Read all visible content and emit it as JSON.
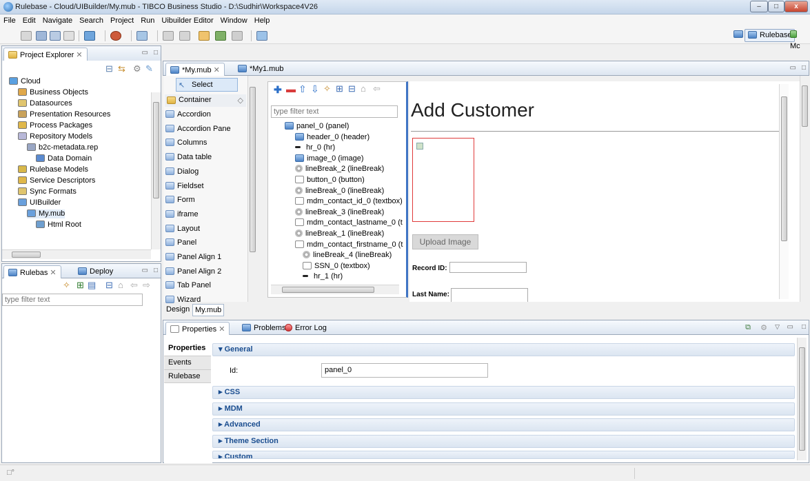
{
  "window": {
    "title": "Rulebase - Cloud/UIBuilder/My.mub - TIBCO Business Studio - D:\\Sudhir\\Workspace4V26",
    "minimize": "–",
    "maximize": "□",
    "close": "x"
  },
  "menu": [
    "File",
    "Edit",
    "Navigate",
    "Search",
    "Project",
    "Run",
    "Uibuilder Editor",
    "Window",
    "Help"
  ],
  "perspectives": {
    "rulebase": "Rulebase",
    "mc": "Mc"
  },
  "project_explorer": {
    "tab": "Project Explorer",
    "items": [
      {
        "label": "Cloud",
        "icon": "cloud-project-icon",
        "depth": 0
      },
      {
        "label": "Business Objects",
        "icon": "business-objects-icon",
        "depth": 1
      },
      {
        "label": "Datasources",
        "icon": "datasources-icon",
        "depth": 1
      },
      {
        "label": "Presentation Resources",
        "icon": "presentation-icon",
        "depth": 1
      },
      {
        "label": "Process Packages",
        "icon": "process-icon",
        "depth": 1
      },
      {
        "label": "Repository Models",
        "icon": "repository-icon",
        "depth": 1
      },
      {
        "label": "b2c-metadata.rep",
        "icon": "rep-file-icon",
        "depth": 2
      },
      {
        "label": "Data Domain",
        "icon": "data-domain-icon",
        "depth": 3
      },
      {
        "label": "Rulebase Models",
        "icon": "rulebase-models-icon",
        "depth": 1
      },
      {
        "label": "Service Descriptors",
        "icon": "service-icon",
        "depth": 1
      },
      {
        "label": "Sync Formats",
        "icon": "sync-icon",
        "depth": 1
      },
      {
        "label": "UIBuilder",
        "icon": "uibuilder-icon",
        "depth": 1
      },
      {
        "label": "My.mub",
        "icon": "mub-file-icon",
        "depth": 2
      },
      {
        "label": "Html Root",
        "icon": "html-root-icon",
        "depth": 3
      }
    ]
  },
  "rulebase_panel": {
    "tab_rulebas": "Rulebas",
    "tab_deploy": "Deploy",
    "filter_placeholder": "type filter text"
  },
  "editor_tabs": [
    "*My.mub",
    "*My1.mub"
  ],
  "palette": {
    "select": "Select",
    "container": "Container",
    "items": [
      "Accordion",
      "Accordion Pane",
      "Columns",
      "Data table",
      "Dialog",
      "Fieldset",
      "Form",
      "iframe",
      "Layout",
      "Panel",
      "Panel Align 1",
      "Panel Align 2",
      "Tab Panel",
      "Wizard"
    ]
  },
  "outline": {
    "filter_placeholder": "type filter text",
    "items": [
      {
        "label": "panel_0 (panel)",
        "depth": 0
      },
      {
        "label": "header_0 (header)",
        "depth": 1
      },
      {
        "label": "hr_0 (hr)",
        "depth": 1
      },
      {
        "label": "image_0 (image)",
        "depth": 1
      },
      {
        "label": "lineBreak_2 (lineBreak)",
        "depth": 1
      },
      {
        "label": "button_0 (button)",
        "depth": 1
      },
      {
        "label": "lineBreak_0 (lineBreak)",
        "depth": 1
      },
      {
        "label": "mdm_contact_id_0 (textbox)",
        "depth": 1
      },
      {
        "label": "lineBreak_3 (lineBreak)",
        "depth": 1
      },
      {
        "label": "mdm_contact_lastname_0 (t",
        "depth": 1
      },
      {
        "label": "lineBreak_1 (lineBreak)",
        "depth": 1
      },
      {
        "label": "mdm_contact_firstname_0 (t",
        "depth": 1
      },
      {
        "label": "lineBreak_4 (lineBreak)",
        "depth": 2
      },
      {
        "label": "SSN_0 (textbox)",
        "depth": 2
      },
      {
        "label": "hr_1 (hr)",
        "depth": 2
      }
    ]
  },
  "canvas": {
    "heading": "Add Customer",
    "upload_button": "Upload Image",
    "record_id_label": "Record ID:",
    "last_name_label": "Last Name:"
  },
  "editor_bottom_tabs": [
    "Design",
    "My.mub"
  ],
  "bottom_tabs": [
    "Properties",
    "Problems",
    "Error Log"
  ],
  "properties": {
    "side_tabs": [
      "Properties",
      "Events",
      "Rulebase"
    ],
    "general": "General",
    "id_label": "Id:",
    "id_value": "panel_0",
    "sections": [
      "CSS",
      "MDM",
      "Advanced",
      "Theme Section",
      "Custom"
    ]
  }
}
